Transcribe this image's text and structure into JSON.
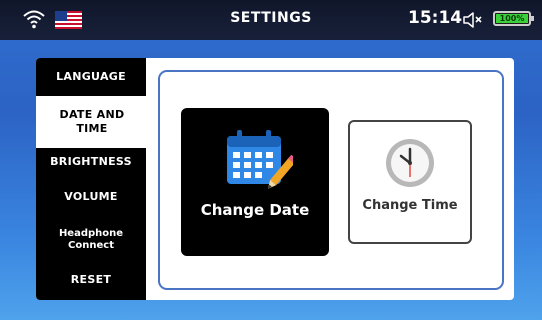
{
  "status_bar": {
    "title": "SETTINGS",
    "time": "15:14",
    "battery": "100%",
    "wifi_icon": "wifi-icon",
    "flag_icon": "us-flag-icon",
    "speaker_icon": "speaker-muted-icon"
  },
  "sidebar": {
    "items": [
      {
        "label": "LANGUAGE"
      },
      {
        "label": "DATE AND TIME"
      },
      {
        "label": "BRIGHTNESS"
      },
      {
        "label": "VOLUME"
      },
      {
        "label": "Headphone Connect"
      },
      {
        "label": "RESET"
      }
    ],
    "active": "DATE AND TIME"
  },
  "main": {
    "change_date": {
      "label": "Change Date",
      "icon": "calendar-icon"
    },
    "change_time": {
      "label": "Change Time",
      "icon": "clock-icon"
    }
  },
  "colors": {
    "background": "#2f6fd0",
    "topbar": "#10162a",
    "battery": "#3ad13a",
    "content_border": "#4a74c4"
  }
}
